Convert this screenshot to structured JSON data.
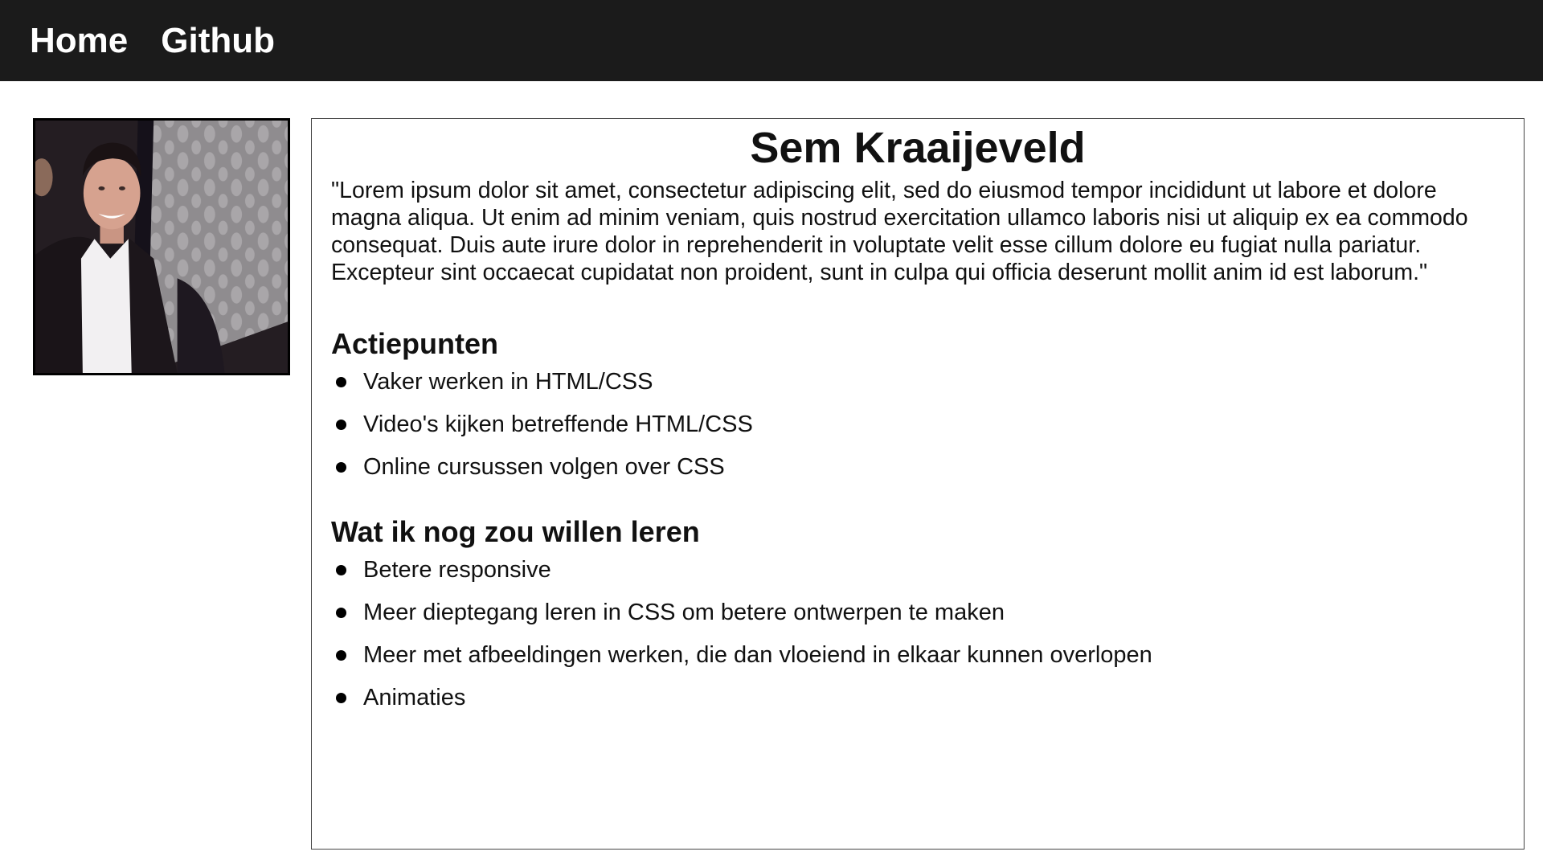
{
  "nav": {
    "items": [
      {
        "label": "Home"
      },
      {
        "label": "Github"
      }
    ]
  },
  "profile": {
    "name": "Sem Kraaijeveld",
    "intro": "\"Lorem ipsum dolor sit amet, consectetur adipiscing elit, sed do eiusmod tempor incididunt ut labore et dolore magna aliqua. Ut enim ad minim veniam, quis nostrud exercitation ullamco laboris nisi ut aliquip ex ea commodo consequat. Duis aute irure dolor in reprehenderit in voluptate velit esse cillum dolore eu fugiat nulla pariatur. Excepteur sint occaecat cupidatat non proident, sunt in culpa qui officia deserunt mollit anim id est laborum.\""
  },
  "sections": [
    {
      "heading": "Actiepunten",
      "items": [
        "Vaker werken in HTML/CSS",
        "Video's kijken betreffende HTML/CSS",
        "Online cursussen volgen over CSS"
      ]
    },
    {
      "heading": "Wat ik nog zou willen leren",
      "items": [
        "Betere responsive",
        "Meer dieptegang leren in CSS om betere ontwerpen te maken",
        "Meer met afbeeldingen werken, die dan vloeiend in elkaar kunnen overlopen",
        "Animaties"
      ]
    }
  ],
  "colors": {
    "navbar_bg": "#1b1b1b",
    "nav_text": "#ffffff",
    "page_bg": "#ffffff",
    "text": "#111111"
  },
  "icons": {
    "bullet": "filled-circle"
  }
}
